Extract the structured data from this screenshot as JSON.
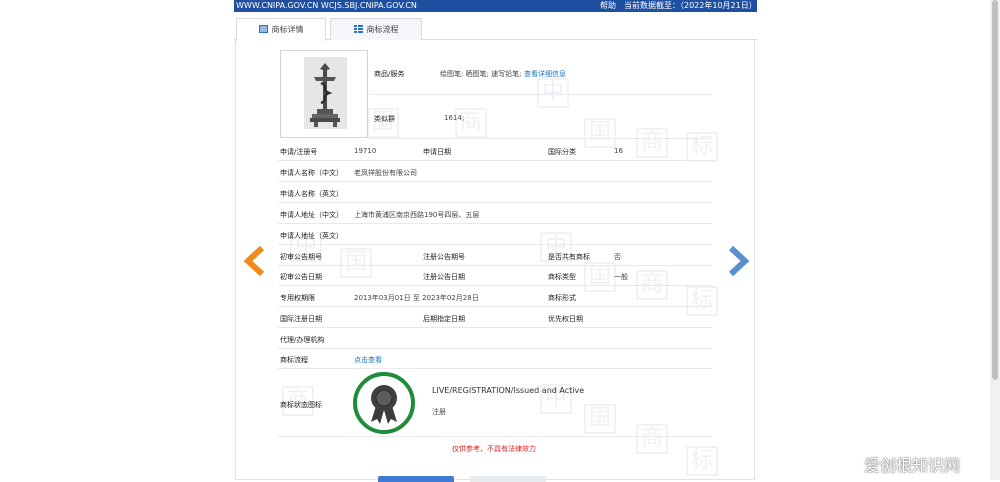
{
  "topbar": {
    "domains": "WWW.CNIPA.GOV.CN WCJS.SBJ.CNIPA.GOV.CN",
    "help": "帮助",
    "as_of": "当前数据截至：（2022年10月21日）"
  },
  "tabs": [
    {
      "label": "商标详情",
      "active": true
    },
    {
      "label": "商标流程",
      "active": false
    }
  ],
  "detail": {
    "goods_label": "商品/服务",
    "goods_value": "绘图笔; 晒图笔; 速写铅笔;",
    "goods_more": "查看详细信息",
    "similar_group_label": "类似群",
    "similar_group_value": "1614;",
    "reg_no_label": "申请/注册号",
    "reg_no_value": "19710",
    "app_date_label": "申请日期",
    "app_date_value": "",
    "intl_class_label": "国际分类",
    "intl_class_value": "16",
    "applicant_cn_label": "申请人名称（中文）",
    "applicant_cn_value": "老凤祥股份有限公司",
    "applicant_en_label": "申请人名称（英文）",
    "applicant_en_value": "",
    "address_cn_label": "申请人地址（中文）",
    "address_cn_value": "上海市黄浦区南京西路190号四层、五层",
    "address_en_label": "申请人地址（英文）",
    "address_en_value": "",
    "prelim_no_label": "初审公告期号",
    "prelim_no_value": "",
    "reg_pub_no_label": "注册公告期号",
    "reg_pub_no_value": "",
    "shared_label": "是否共有商标",
    "shared_value": "否",
    "prelim_date_label": "初审公告日期",
    "prelim_date_value": "",
    "reg_pub_date_label": "注册公告日期",
    "reg_pub_date_value": "",
    "mark_type_label": "商标类型",
    "mark_type_value": "一般",
    "exclusive_label": "专用权期限",
    "exclusive_value": "2013年03月01日 至 2023年02月28日",
    "mark_form_label": "商标形式",
    "mark_form_value": "",
    "intl_reg_date_label": "国际注册日期",
    "intl_reg_date_value": "",
    "later_designation_label": "后期指定日期",
    "later_designation_value": "",
    "priority_date_label": "优先权日期",
    "priority_date_value": "",
    "agent_label": "代理/办理机构",
    "agent_value": "",
    "process_label": "商标流程",
    "process_link": "点击查看",
    "status_label": "商标状态图标",
    "status_en": "LIVE/REGISTRATION/Issued and Active",
    "status_cn": "注册"
  },
  "disclaimer": "仅供参考，不具有法律效力",
  "watermark_chars": [
    "中",
    "国",
    "商",
    "标"
  ],
  "site_logo": "爱创根知识网",
  "colors": {
    "topbar": "#1f4fa0",
    "link": "#1a73c5",
    "arrow_left": "#f08a1c",
    "arrow_right": "#5b8fce",
    "status_ring": "#1e8c3a",
    "disclaimer": "#dd2222"
  },
  "icons": {
    "tab_detail": "list-icon",
    "tab_process": "flow-icon",
    "prev": "arrow-left-icon",
    "next": "arrow-right-icon",
    "status": "award-ribbon-icon"
  }
}
